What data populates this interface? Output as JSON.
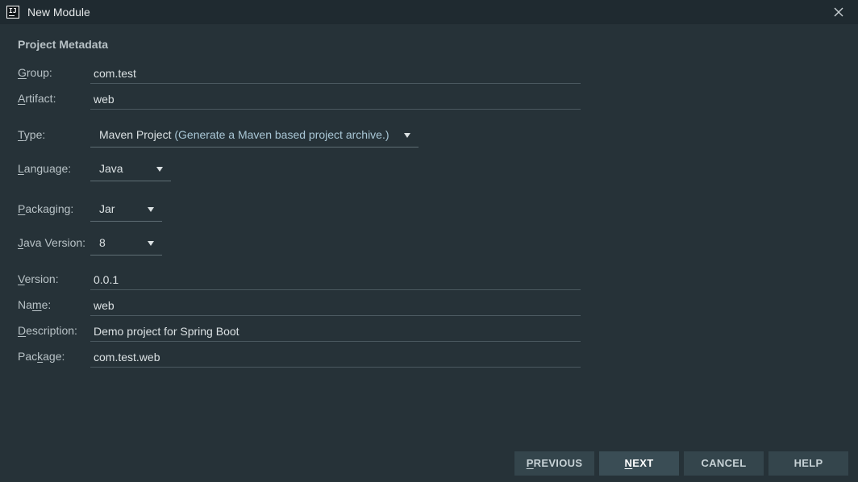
{
  "window": {
    "title": "New Module",
    "app_icon_text": "IJ"
  },
  "section": {
    "title": "Project Metadata"
  },
  "fields": {
    "group": {
      "mnemonic": "G",
      "rest": "roup:",
      "value": "com.test"
    },
    "artifact": {
      "mnemonic": "A",
      "rest": "rtifact:",
      "value": "web"
    },
    "type": {
      "mnemonic": "T",
      "rest": "ype:",
      "value": "Maven Project",
      "hint": "(Generate a Maven based project archive.)"
    },
    "language": {
      "mnemonic": "L",
      "rest": "anguage:",
      "value": "Java"
    },
    "packaging": {
      "mnemonic": "P",
      "rest": "ackaging:",
      "value": "Jar"
    },
    "java_version": {
      "mnemonic": "J",
      "rest": "ava Version:",
      "value": "8"
    },
    "version": {
      "mnemonic": "V",
      "rest": "ersion:",
      "value": "0.0.1"
    },
    "name": {
      "pre": "Na",
      "mnemonic": "m",
      "rest": "e:",
      "value": "web"
    },
    "description": {
      "mnemonic": "D",
      "rest": "escription:",
      "value": "Demo project for Spring Boot"
    },
    "package": {
      "pre": "Pac",
      "mnemonic": "k",
      "rest": "age:",
      "value": "com.test.web"
    }
  },
  "buttons": {
    "previous": {
      "mnemonic": "P",
      "rest": "REVIOUS"
    },
    "next": {
      "mnemonic": "N",
      "rest": "EXT"
    },
    "cancel": {
      "label": "CANCEL"
    },
    "help": {
      "label": "HELP"
    }
  },
  "icons": {
    "app": "intellij-icon",
    "close": "close-icon",
    "dropdown": "dropdown-arrow-icon"
  },
  "colors": {
    "background": "#263238",
    "titlebar": "#1f2a30",
    "button": "#34454c",
    "hint_text": "#a9c7d6"
  }
}
